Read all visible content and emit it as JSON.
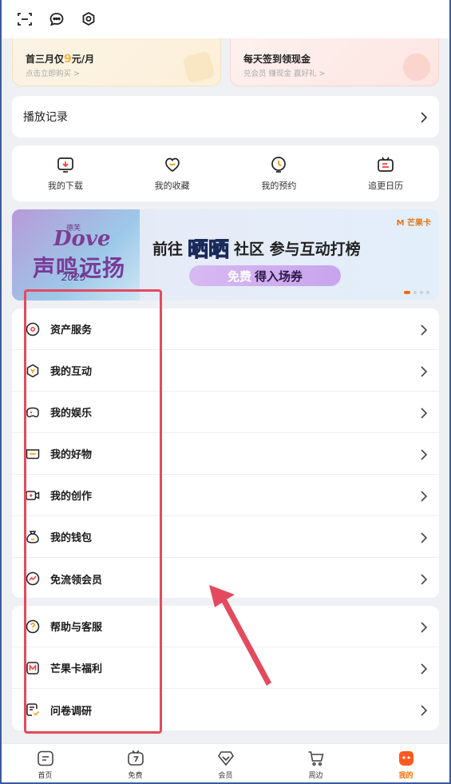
{
  "topbar": {
    "icons": [
      "scan-icon",
      "message-icon",
      "settings-icon"
    ]
  },
  "promos": [
    {
      "title_prefix": "首三月仅",
      "title_num": "9",
      "title_suffix": "元/月",
      "subtitle": "点击立即购买 >"
    },
    {
      "title": "每天签到领现金",
      "subtitle": "兑会员 赚现金 赢好礼 >"
    }
  ],
  "history": {
    "label": "播放记录"
  },
  "quick_actions": [
    {
      "label": "我的下载",
      "icon": "download-icon"
    },
    {
      "label": "我的收藏",
      "icon": "favorite-icon"
    },
    {
      "label": "我的预约",
      "icon": "clock-icon"
    },
    {
      "label": "追更日历",
      "icon": "calendar-icon"
    }
  ],
  "banner": {
    "brand_small": "德芙",
    "brand": "Dove",
    "script": "声鸣远扬",
    "year": "2025",
    "headline_pre": "前往",
    "headline_highlight": "晒晒",
    "headline_post": "社区 参与互动打榜",
    "cta_free": "免费",
    "cta_rest": "得入场券",
    "logos": "M 芒果卡"
  },
  "menu": [
    {
      "label": "资产服务",
      "icon": "asset-icon"
    },
    {
      "label": "我的互动",
      "icon": "interaction-icon"
    },
    {
      "label": "我的娱乐",
      "icon": "entertainment-icon"
    },
    {
      "label": "我的好物",
      "icon": "goods-icon"
    },
    {
      "label": "我的创作",
      "icon": "creation-icon"
    },
    {
      "label": "我的钱包",
      "icon": "wallet-icon"
    },
    {
      "label": "免流领会员",
      "icon": "free-data-icon"
    }
  ],
  "menu2": [
    {
      "label": "帮助与客服",
      "icon": "help-icon"
    },
    {
      "label": "芒果卡福利",
      "icon": "mango-card-icon"
    },
    {
      "label": "问卷调研",
      "icon": "survey-icon"
    }
  ],
  "bottom_nav": [
    {
      "label": "首页",
      "icon": "home-icon"
    },
    {
      "label": "免费",
      "icon": "free-tv-icon"
    },
    {
      "label": "会员",
      "icon": "vip-icon"
    },
    {
      "label": "周边",
      "icon": "cart-icon"
    },
    {
      "label": "我的",
      "icon": "profile-icon",
      "active": true
    }
  ],
  "colors": {
    "accent": "#ff6a00",
    "highlight_box": "#e44a5e"
  }
}
